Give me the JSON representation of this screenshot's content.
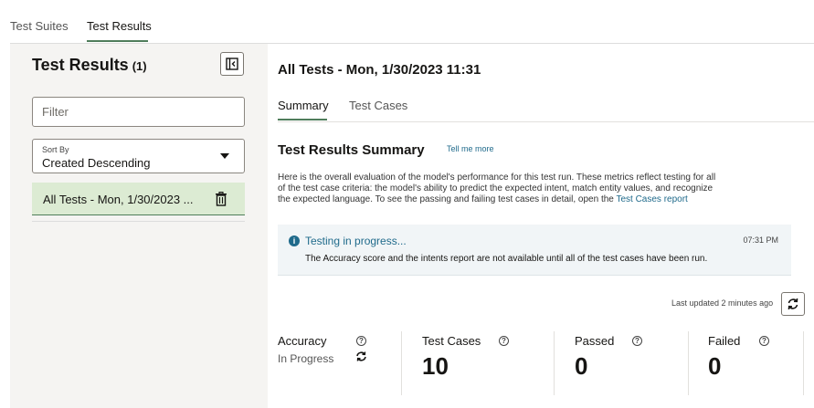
{
  "top_tabs": [
    {
      "label": "Test Suites",
      "active": false
    },
    {
      "label": "Test Results",
      "active": true
    }
  ],
  "left_panel": {
    "title": "Test Results",
    "count": "(1)",
    "filter_placeholder": "Filter",
    "sort_label": "Sort By",
    "sort_value": "Created Descending",
    "items": [
      {
        "label": "All Tests - Mon, 1/30/2023 ..."
      }
    ]
  },
  "right_panel": {
    "title": "All Tests - Mon, 1/30/2023 11:31",
    "tabs": [
      {
        "label": "Summary",
        "active": true
      },
      {
        "label": "Test Cases",
        "active": false
      }
    ],
    "summary_title": "Test Results Summary",
    "tell_me_more": "Tell me more",
    "description_lines": [
      "Here is the overall evaluation of the model's performance for this test run. These metrics reflect testing for all",
      "of the test case criteria: the model's ability to predict the expected intent, match entity values, and recognize",
      "the expected language. To see the passing and failing test cases in detail, open the "
    ],
    "description_link": "Test Cases report",
    "banner": {
      "title": "Testing in progress...",
      "time": "07:31 PM",
      "message": "The Accuracy score and the intents report are not available until all of the test cases have been run."
    },
    "last_updated": "Last updated 2 minutes ago",
    "metrics": {
      "accuracy_label": "Accuracy",
      "accuracy_status": "In Progress",
      "test_cases_label": "Test Cases",
      "test_cases_value": "10",
      "passed_label": "Passed",
      "passed_value": "0",
      "failed_label": "Failed",
      "failed_value": "0"
    }
  },
  "icons": {
    "collapse": "collapse-panel-icon",
    "trash": "trash-icon",
    "info": "info-icon",
    "refresh": "refresh-icon",
    "help": "help-icon"
  },
  "colors": {
    "accent": "#4f7d5b",
    "selected_row": "#dcebd3",
    "link": "#1f6a8b",
    "panel_bg": "#f5f4f2"
  }
}
